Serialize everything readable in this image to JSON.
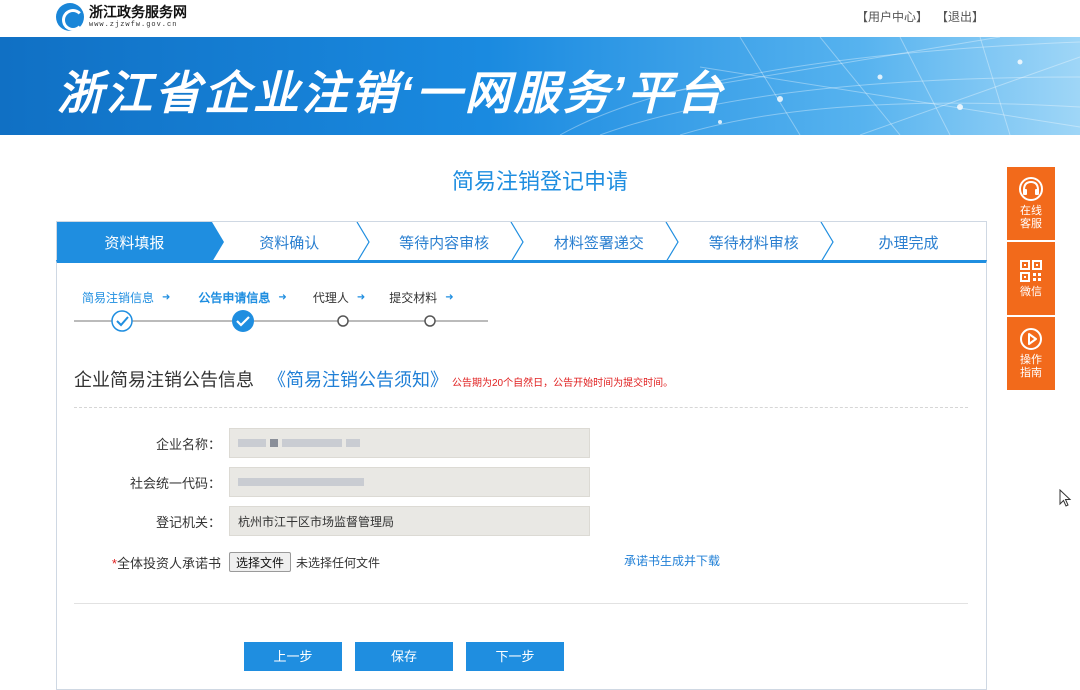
{
  "header": {
    "logo_title": "浙江政务服务网",
    "logo_url": "www.zjzwfw.gov.cn",
    "user_center": "【用户中心】",
    "logout": "【退出】"
  },
  "banner": {
    "title": "浙江省企业注销‘一网服务’平台"
  },
  "page_title": "简易注销登记申请",
  "steps": [
    {
      "label": "资料填报",
      "active": true
    },
    {
      "label": "资料确认"
    },
    {
      "label": "等待内容审核"
    },
    {
      "label": "材料签署递交"
    },
    {
      "label": "等待材料审核"
    },
    {
      "label": "办理完成"
    }
  ],
  "substeps": [
    {
      "label": "简易注销信息",
      "state": "done"
    },
    {
      "label": "公告申请信息",
      "state": "current"
    },
    {
      "label": "代理人",
      "state": "todo"
    },
    {
      "label": "提交材料",
      "state": "todo"
    }
  ],
  "section": {
    "title": "企业简易注销公告信息",
    "notice_link": "《简易注销公告须知》",
    "notice_text": "公告期为20个自然日，公告开始时间为提交时间。"
  },
  "form": {
    "company_name_label": "企业名称：",
    "credit_code_label": "社会统一代码：",
    "authority_label": "登记机关：",
    "authority_value": "杭州市江干区市场监督管理局",
    "commitment_required": "*",
    "commitment_label": "全体投资人承诺书",
    "file_button": "选择文件",
    "file_status": "未选择任何文件",
    "generate_link": "承诺书生成并下载"
  },
  "buttons": {
    "prev": "上一步",
    "save": "保存",
    "next": "下一步"
  },
  "sidebar": {
    "service": "在线\n客服",
    "wechat": "微信",
    "guide": "操作\n指南"
  },
  "colors": {
    "primary": "#1f8ee0",
    "accent": "#f26a1b",
    "required": "#e02020"
  }
}
